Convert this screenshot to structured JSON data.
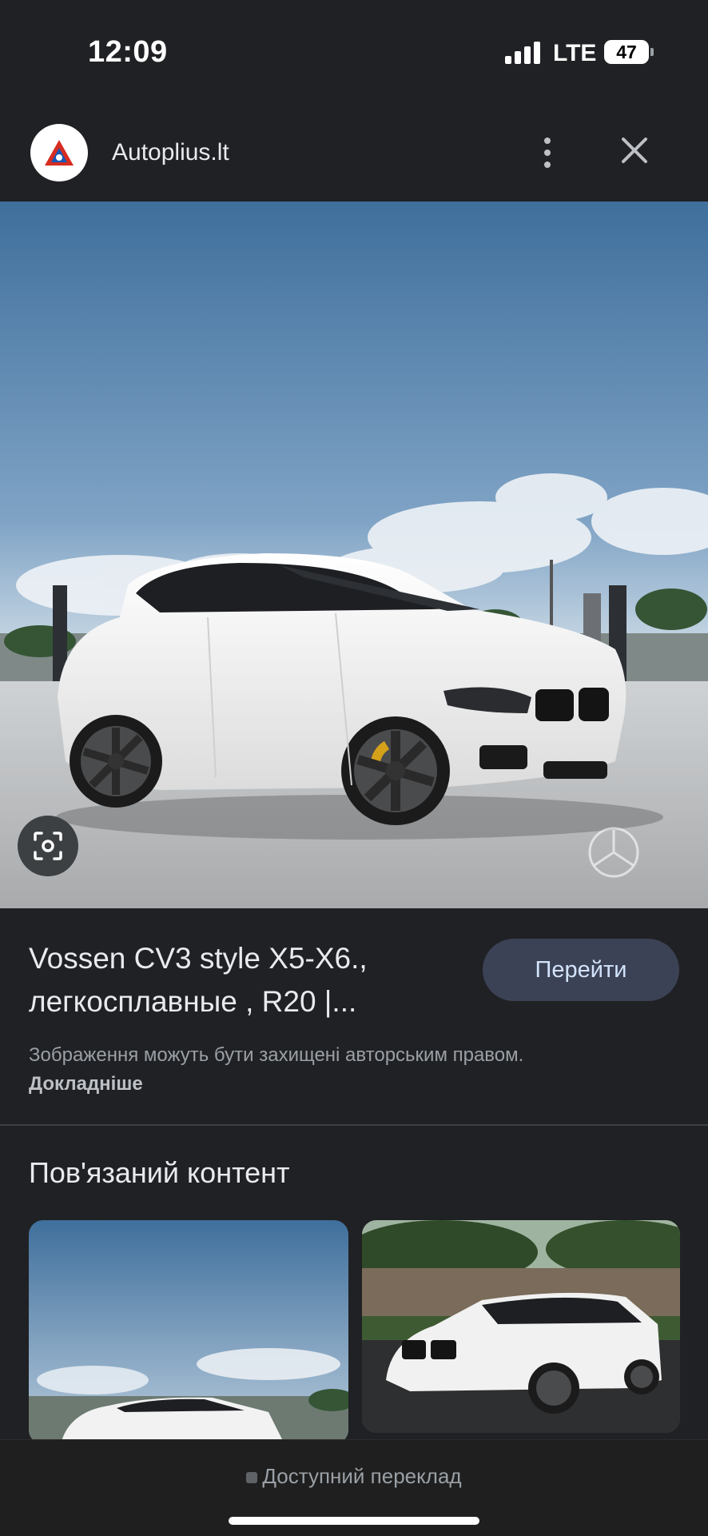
{
  "status_bar": {
    "time": "12:09",
    "network": "LTE",
    "battery": "47"
  },
  "header": {
    "site_name": "Autoplius.lt"
  },
  "result": {
    "title_line1": "Vossen CV3 style X5-X6.,",
    "title_line2": "легкосплавные , R20 |...",
    "go_button": "Перейти",
    "copyright_text": "Зображення можуть бути захищені авторським правом.",
    "copyright_link": "Докладніше"
  },
  "related": {
    "heading": "Пов'язаний контент"
  },
  "bottom": {
    "url_text": "Доступний переклад"
  },
  "colors": {
    "background": "#202124",
    "button_bg": "#3c4255",
    "button_text": "#d2e3fc",
    "car": "#f4f4f4"
  }
}
